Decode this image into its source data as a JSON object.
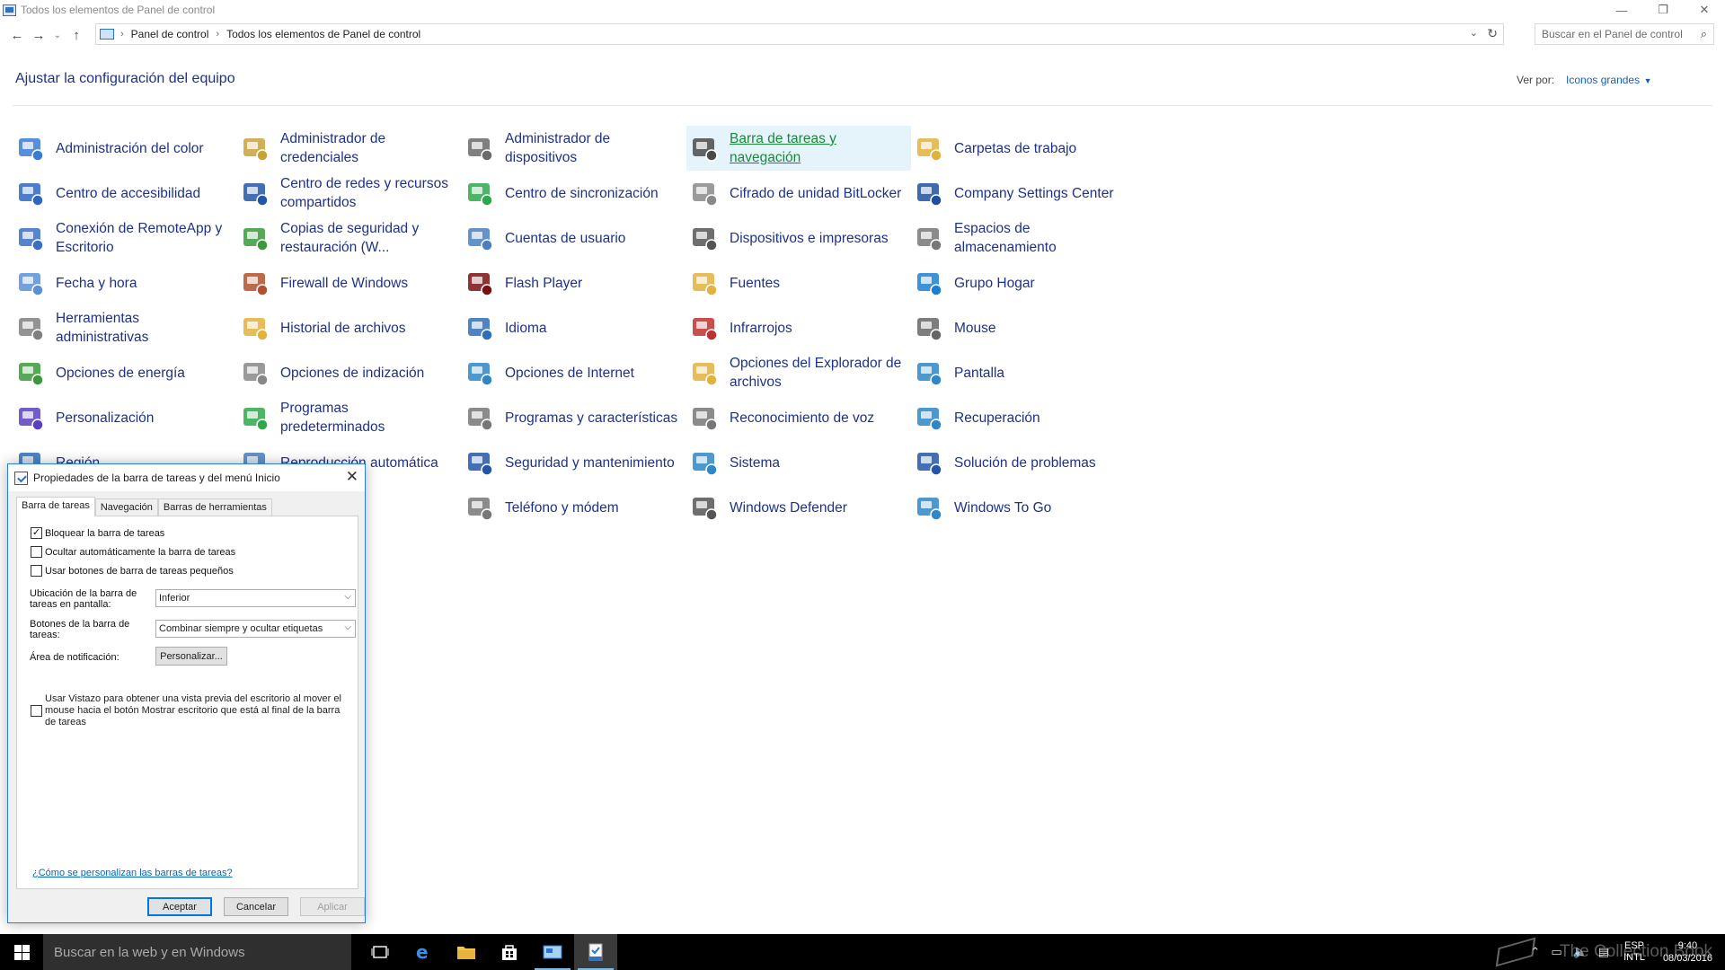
{
  "window": {
    "title": "Todos los elementos de Panel de control",
    "minimize": "—",
    "restore": "❐",
    "close": "✕"
  },
  "nav": {
    "back": "←",
    "forward": "→",
    "recent": "⌄",
    "up": "↑",
    "breadcrumb": [
      "Panel de control",
      "Todos los elementos de Panel de control"
    ],
    "search_placeholder": "Buscar en el Panel de control"
  },
  "header": {
    "title": "Ajustar la configuración del equipo",
    "view_by_label": "Ver por:",
    "view_by_value": "Iconos grandes"
  },
  "items": [
    {
      "label": "Administración del color",
      "icon": "color-management-icon",
      "color": "#3a7bd5"
    },
    {
      "label": "Administrador de credenciales",
      "icon": "credential-manager-icon",
      "color": "#c9a23a"
    },
    {
      "label": "Administrador de dispositivos",
      "icon": "device-manager-icon",
      "color": "#6a6a6a"
    },
    {
      "label": "Barra de tareas y navegación",
      "icon": "taskbar-navigation-icon",
      "color": "#4a4a4a"
    },
    {
      "label": "Carpetas de trabajo",
      "icon": "work-folders-icon",
      "color": "#e2b23c"
    },
    {
      "label": "Centro de accesibilidad",
      "icon": "ease-of-access-icon",
      "color": "#2f66c4"
    },
    {
      "label": "Centro de redes y recursos compartidos",
      "icon": "network-sharing-icon",
      "color": "#2456a6"
    },
    {
      "label": "Centro de sincronización",
      "icon": "sync-center-icon",
      "color": "#2ea84a"
    },
    {
      "label": "Cifrado de unidad BitLocker",
      "icon": "bitlocker-icon",
      "color": "#8a8a8a"
    },
    {
      "label": "Company Settings Center",
      "icon": "company-settings-icon",
      "color": "#1e4fa0"
    },
    {
      "label": "Conexión de RemoteApp y Escritorio",
      "icon": "remoteapp-icon",
      "color": "#3a6fc4"
    },
    {
      "label": "Copias de seguridad y restauración (W...",
      "icon": "backup-restore-icon",
      "color": "#3a9a3a"
    },
    {
      "label": "Cuentas de usuario",
      "icon": "user-accounts-icon",
      "color": "#4a7fc0"
    },
    {
      "label": "Dispositivos e impresoras",
      "icon": "devices-printers-icon",
      "color": "#555555"
    },
    {
      "label": "Espacios de almacenamiento",
      "icon": "storage-spaces-icon",
      "color": "#777777"
    },
    {
      "label": "Fecha y hora",
      "icon": "date-time-icon",
      "color": "#5b8fd8"
    },
    {
      "label": "Firewall de Windows",
      "icon": "firewall-icon",
      "color": "#b0522e"
    },
    {
      "label": "Flash Player",
      "icon": "flash-player-icon",
      "color": "#7a1010"
    },
    {
      "label": "Fuentes",
      "icon": "fonts-icon",
      "color": "#e2b23c"
    },
    {
      "label": "Grupo Hogar",
      "icon": "homegroup-icon",
      "color": "#1e7fd0"
    },
    {
      "label": "Herramientas administrativas",
      "icon": "admin-tools-icon",
      "color": "#808080"
    },
    {
      "label": "Historial de archivos",
      "icon": "file-history-icon",
      "color": "#e2b23c"
    },
    {
      "label": "Idioma",
      "icon": "language-icon",
      "color": "#2f6fb8"
    },
    {
      "label": "Infrarrojos",
      "icon": "infrared-icon",
      "color": "#c03030"
    },
    {
      "label": "Mouse",
      "icon": "mouse-icon",
      "color": "#666666"
    },
    {
      "label": "Opciones de energía",
      "icon": "power-options-icon",
      "color": "#3a9a3a"
    },
    {
      "label": "Opciones de indización",
      "icon": "indexing-options-icon",
      "color": "#888888"
    },
    {
      "label": "Opciones de Internet",
      "icon": "internet-options-icon",
      "color": "#2f86c8"
    },
    {
      "label": "Opciones del Explorador de archivos",
      "icon": "file-explorer-options-icon",
      "color": "#e2b23c"
    },
    {
      "label": "Pantalla",
      "icon": "display-icon",
      "color": "#2f86c8"
    },
    {
      "label": "Personalización",
      "icon": "personalization-icon",
      "color": "#5a3fc0"
    },
    {
      "label": "Programas predeterminados",
      "icon": "default-programs-icon",
      "color": "#2ea84a"
    },
    {
      "label": "Programas y características",
      "icon": "programs-features-icon",
      "color": "#777777"
    },
    {
      "label": "Reconocimiento de voz",
      "icon": "speech-recognition-icon",
      "color": "#777777"
    },
    {
      "label": "Recuperación",
      "icon": "recovery-icon",
      "color": "#2f86c8"
    },
    {
      "label": "Región",
      "icon": "region-icon",
      "color": "#2f6fb8"
    },
    {
      "label": "Reproducción automática",
      "icon": "autoplay-icon",
      "color": "#4a7fc0"
    },
    {
      "label": "Seguridad y mantenimiento",
      "icon": "security-maintenance-icon",
      "color": "#2456a6"
    },
    {
      "label": "Sistema",
      "icon": "system-icon",
      "color": "#2f86c8"
    },
    {
      "label": "Solución de problemas",
      "icon": "troubleshooting-icon",
      "color": "#2456a6"
    },
    {
      "label": "",
      "icon": "",
      "color": ""
    },
    {
      "label": "",
      "icon": "",
      "color": ""
    },
    {
      "label": "Teléfono y módem",
      "icon": "phone-modem-icon",
      "color": "#777777"
    },
    {
      "label": "Windows Defender",
      "icon": "windows-defender-icon",
      "color": "#555555"
    },
    {
      "label": "Windows To Go",
      "icon": "windows-to-go-icon",
      "color": "#2f86c8"
    }
  ],
  "dialog": {
    "title": "Propiedades de la barra de tareas y del menú Inicio",
    "close": "✕",
    "tabs": [
      "Barra de tareas",
      "Navegación",
      "Barras de herramientas"
    ],
    "checks": [
      {
        "label": "Bloquear la barra de tareas",
        "checked": true
      },
      {
        "label": "Ocultar automáticamente la barra de tareas",
        "checked": false
      },
      {
        "label": "Usar botones de barra de tareas pequeños",
        "checked": false
      }
    ],
    "location_label": "Ubicación de la barra de tareas en pantalla:",
    "location_value": "Inferior",
    "buttons_label": "Botones de la barra de tareas:",
    "buttons_value": "Combinar siempre y ocultar etiquetas",
    "notif_label": "Área de notificación:",
    "customize_button": "Personalizar...",
    "peek_label": "Usar Vistazo para obtener una vista previa del escritorio al mover el mouse hacia el botón Mostrar escritorio que está al final de la barra de tareas",
    "peek_checked": false,
    "help_link": "¿Cómo se personalizan las barras de tareas?",
    "ok": "Aceptar",
    "cancel": "Cancelar",
    "apply": "Aplicar"
  },
  "taskbar": {
    "search_placeholder": "Buscar en la web y en Windows",
    "lang_top": "ESP",
    "lang_bottom": "INTL",
    "time": "9:40",
    "date": "08/03/2016",
    "watermark": "The Collection Book"
  }
}
